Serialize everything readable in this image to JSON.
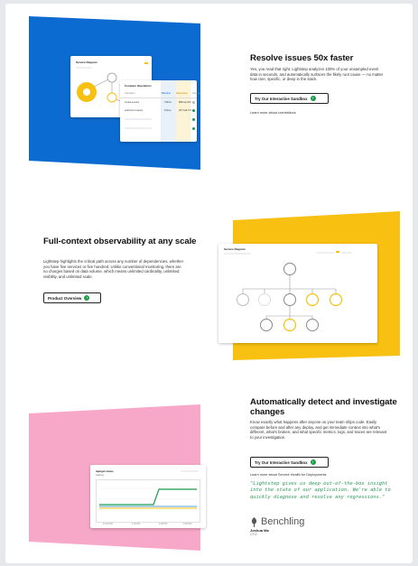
{
  "colors": {
    "blue": "#0c6bd0",
    "yellow": "#f8c010",
    "pink": "#f7a8c8",
    "green": "#1b9e4b",
    "quote_green": "#2d9b5a"
  },
  "icons": {
    "button_arrow": "arrow-right-circle-icon",
    "brand": "benchling-feather-icon"
  },
  "section1": {
    "title": "Resolve issues 50x faster",
    "body": "Yes, you read that right. Lightstep analyzes 100% of your unsampled event data in seconds, and automatically surfaces the likely root cause — no matter how rare, specific, or deep in the stack.",
    "button": "Try Our Interactive Sandbox",
    "link": "Learn more about correlations",
    "diagram_title": "Service Diagram",
    "compare": {
      "title": "Compare Operations",
      "headers": [
        "Operation",
        "Baseline",
        "Regression",
        "Change"
      ],
      "rows": [
        [
          "create-invoice",
          "790ms",
          "880ms",
          "+14%"
        ],
        [
          "authorize-request",
          "611ms",
          "48.7ms",
          "-2.7%"
        ]
      ]
    }
  },
  "section2": {
    "title": "Full-context observability at any scale",
    "body": "Lightstep highlights the critical path across any number of dependencies, whether you have five services or five hundred. Unlike conventional monitoring, there are no charges based on data volume, which means unlimited cardinality, unlimited visibility, and unlimited scale.",
    "button": "Product Overview",
    "diagram_title": "Service Diagram"
  },
  "section3": {
    "title": "Automatically detect and investigate changes",
    "body": "Know exactly what happens after anyone on your team ships code. Easily compare before and after any deploy, and get immediate context into what's different, what's broken, and what specific metrics, logs, and traces are relevant to your investigation.",
    "button": "Try Our Interactive Sandbox",
    "link": "Learn more about Service Health for Deployments",
    "quote": "\"Lightstep gives us deep out-of-the-box insight into the state of our application. We're able to quickly diagnose and resolve any regressions.\"",
    "brand": "Benchling",
    "person_name": "Joshua Ma",
    "person_title": "CTO",
    "chart": {
      "title": "/api/get-views",
      "subtitle": "Latency",
      "x_ticks": [
        "12:00 PM",
        "1:00 PM",
        "2:00 PM",
        "3:00 PM"
      ]
    }
  }
}
